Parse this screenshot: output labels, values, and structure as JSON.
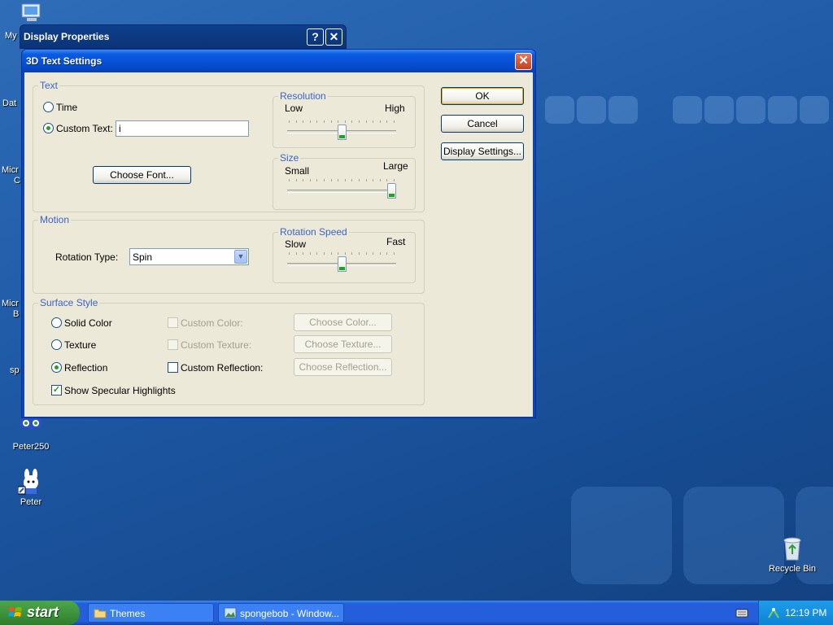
{
  "desktop": {
    "icons": [
      {
        "label": "Peter250"
      },
      {
        "label": "Peter"
      },
      {
        "label": "Recycle Bin"
      }
    ],
    "partial_labels": [
      "My",
      "Dat",
      "Micr",
      "C",
      "Micr",
      "B",
      "sp"
    ]
  },
  "background_window": {
    "title": "Display Properties",
    "help_symbol": "?",
    "close_symbol": "✕"
  },
  "dialog": {
    "title": "3D Text Settings",
    "close_symbol": "✕",
    "text_group": {
      "label": "Text",
      "time_label": "Time",
      "custom_text_label": "Custom Text:",
      "custom_text_value": "i",
      "choose_font_label": "Choose Font..."
    },
    "resolution": {
      "label": "Resolution",
      "low": "Low",
      "high": "High",
      "value_fraction": 0.5
    },
    "size": {
      "label": "Size",
      "small": "Small",
      "large": "Large",
      "value_fraction": 1.0
    },
    "motion_group": {
      "label": "Motion",
      "rotation_type_label": "Rotation Type:",
      "rotation_type_value": "Spin"
    },
    "rotation_speed": {
      "label": "Rotation Speed",
      "slow": "Slow",
      "fast": "Fast",
      "value_fraction": 0.5
    },
    "surface_group": {
      "label": "Surface Style",
      "solid_color": "Solid Color",
      "texture": "Texture",
      "reflection": "Reflection",
      "custom_color": "Custom Color:",
      "custom_texture": "Custom Texture:",
      "custom_reflection": "Custom Reflection:",
      "choose_color": "Choose Color...",
      "choose_texture": "Choose Texture...",
      "choose_reflection": "Choose Reflection...",
      "show_specular": "Show Specular Highlights",
      "selected": "Reflection"
    },
    "buttons": {
      "ok": "OK",
      "cancel": "Cancel",
      "display_settings": "Display Settings..."
    }
  },
  "taskbar": {
    "start_label": "start",
    "tasks": [
      {
        "label": "Themes"
      },
      {
        "label": "spongebob - Window..."
      }
    ],
    "clock": "12:19 PM"
  },
  "colors": {
    "accent_blue": "#0a5be0",
    "group_label": "#3c64c8",
    "dialog_bg": "#ece9d8",
    "check_green": "#21a121"
  }
}
